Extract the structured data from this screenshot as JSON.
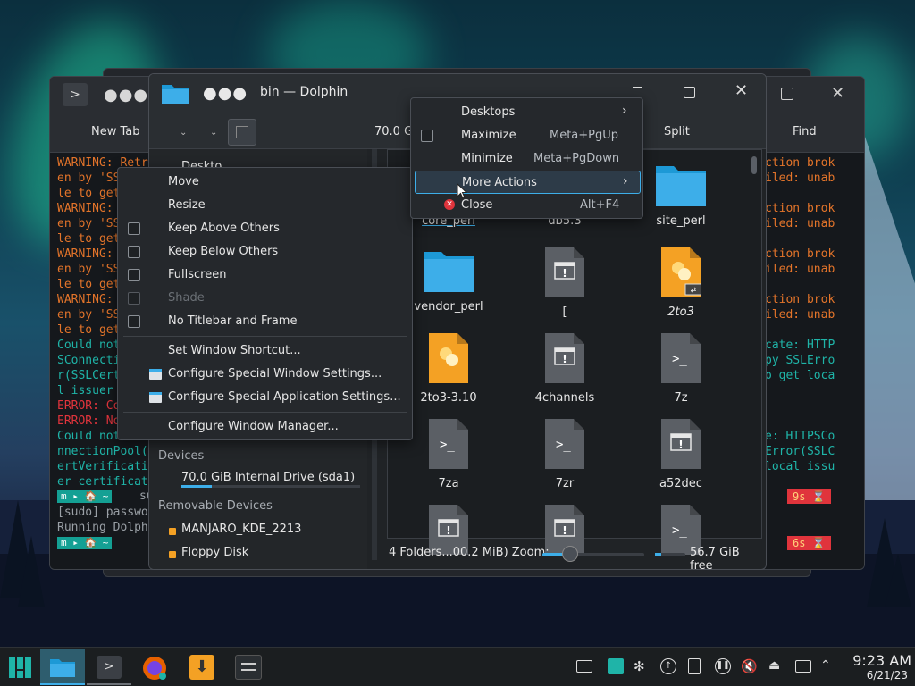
{
  "konsole": {
    "new_tab_label": "New Tab",
    "find_label": "Find",
    "lines_left": [
      {
        "text": "WARNING: Retr",
        "cls": "warn"
      },
      {
        "text": "en by 'SS",
        "cls": "warn"
      },
      {
        "text": "le to get",
        "cls": "warn"
      },
      {
        "text": "WARNING: ",
        "cls": "warn"
      },
      {
        "text": "en by 'SS",
        "cls": "warn"
      },
      {
        "text": "le to get",
        "cls": "warn"
      },
      {
        "text": "WARNING: ",
        "cls": "warn"
      },
      {
        "text": "en by 'SS",
        "cls": "warn"
      },
      {
        "text": "le to get",
        "cls": "warn"
      },
      {
        "text": "WARNING: ",
        "cls": "warn"
      },
      {
        "text": "en by 'SS",
        "cls": "warn"
      },
      {
        "text": "le to get",
        "cls": "warn"
      },
      {
        "text": "Could not",
        "cls": "cyan"
      },
      {
        "text": "SConnecti",
        "cls": "cyan"
      },
      {
        "text": "r(SSLCert",
        "cls": "cyan"
      },
      {
        "text": "l issuer ",
        "cls": "cyan"
      },
      {
        "text": "ERROR: Co",
        "cls": "err"
      },
      {
        "text": "ERROR: No",
        "cls": "err"
      },
      {
        "text": "Could not",
        "cls": "cyan"
      },
      {
        "text": "nnectionPool(",
        "cls": "cyan"
      },
      {
        "text": "ertVerificati",
        "cls": "cyan"
      },
      {
        "text": "er certificat",
        "cls": "cyan"
      }
    ],
    "lines_right": [
      {
        "text": "ction brok",
        "cls": "warn"
      },
      {
        "text": "iled: unab",
        "cls": "warn"
      },
      {
        "text": "",
        "cls": "warn"
      },
      {
        "text": "ction brok",
        "cls": "warn"
      },
      {
        "text": "iled: unab",
        "cls": "warn"
      },
      {
        "text": "",
        "cls": "warn"
      },
      {
        "text": "ction brok",
        "cls": "warn"
      },
      {
        "text": "iled: unab",
        "cls": "warn"
      },
      {
        "text": "",
        "cls": "warn"
      },
      {
        "text": "ction brok",
        "cls": "warn"
      },
      {
        "text": "iled: unab",
        "cls": "warn"
      },
      {
        "text": "",
        "cls": "warn"
      },
      {
        "text": "cate: HTTP",
        "cls": "cyan"
      },
      {
        "text": "py SSLErro",
        "cls": "cyan"
      },
      {
        "text": "o get loca",
        "cls": "cyan"
      },
      {
        "text": "",
        "cls": "cyan"
      },
      {
        "text": "",
        "cls": "cyan"
      },
      {
        "text": "",
        "cls": "cyan"
      },
      {
        "text": "e: HTTPSCo",
        "cls": "cyan"
      },
      {
        "text": "Error(SSLC",
        "cls": "cyan"
      },
      {
        "text": "local issu",
        "cls": "cyan"
      },
      {
        "text": "",
        "cls": "cyan"
      }
    ],
    "prompt1_cmd": "su",
    "sudo_line": "[sudo] passwo",
    "running_line": "Running Dolph",
    "time1": "9s ⌛",
    "time2": "6s ⌛",
    "prompt_pill": "m ▸ 🏠 ~"
  },
  "dolphin": {
    "title": "bin — Dolphin",
    "size_label": "70.0 Gi",
    "split_label": "Split",
    "sidebar": {
      "partial_top": "Deskto",
      "devices_heading": "Devices",
      "internal_drive": "70.0 GiB Internal Drive (sda1)",
      "internal_drive_usage": 0.17,
      "removable_heading": "Removable Devices",
      "removable": [
        "MANJARO_KDE_2213",
        "Floppy Disk"
      ]
    },
    "files": [
      {
        "name": "core_perl",
        "kind": "folder"
      },
      {
        "name": "db5.3",
        "kind": "folder"
      },
      {
        "name": "site_perl",
        "kind": "folder"
      },
      {
        "name": "vendor_perl",
        "kind": "folder"
      },
      {
        "name": "[",
        "kind": "exec"
      },
      {
        "name": "2to3",
        "kind": "python-link"
      },
      {
        "name": "2to3-3.10",
        "kind": "python"
      },
      {
        "name": "4channels",
        "kind": "exec"
      },
      {
        "name": "7z",
        "kind": "script"
      },
      {
        "name": "7za",
        "kind": "script"
      },
      {
        "name": "7zr",
        "kind": "script"
      },
      {
        "name": "a52dec",
        "kind": "exec"
      },
      {
        "name": "",
        "kind": "exec"
      },
      {
        "name": "",
        "kind": "exec"
      },
      {
        "name": "",
        "kind": "script"
      }
    ],
    "status": {
      "summary": "4 Folders...00.2 MiB) Zoom:",
      "zoom_level": 0.3,
      "free_label": "56.7 GiB free",
      "free_usage": 0.2
    }
  },
  "window_menu": {
    "items": [
      {
        "label": "Move",
        "type": "plain"
      },
      {
        "label": "Resize",
        "type": "plain"
      },
      {
        "label": "Keep Above Others",
        "type": "check",
        "checked": false
      },
      {
        "label": "Keep Below Others",
        "type": "check",
        "checked": false
      },
      {
        "label": "Fullscreen",
        "type": "check",
        "checked": false
      },
      {
        "label": "Shade",
        "type": "check",
        "checked": false,
        "disabled": true
      },
      {
        "label": "No Titlebar and Frame",
        "type": "check",
        "checked": false
      }
    ],
    "shortcut_label": "Set Window Shortcut...",
    "special_window": "Configure Special Window Settings...",
    "special_app": "Configure Special Application Settings...",
    "configure_wm": "Configure Window Manager..."
  },
  "submenu": {
    "desktops": "Desktops",
    "maximize": "Maximize",
    "maximize_sc": "Meta+PgUp",
    "minimize": "Minimize",
    "minimize_sc": "Meta+PgDown",
    "more_actions": "More Actions",
    "close": "Close",
    "close_sc": "Alt+F4"
  },
  "taskbar": {
    "time": "9:23 AM",
    "date": "6/21/23"
  },
  "colors": {
    "accent": "#3daee9",
    "warning": "#e3742a",
    "info": "#1fb4a8",
    "error": "#e0343c",
    "folder": "#3daee9",
    "python": "#f4a124"
  }
}
